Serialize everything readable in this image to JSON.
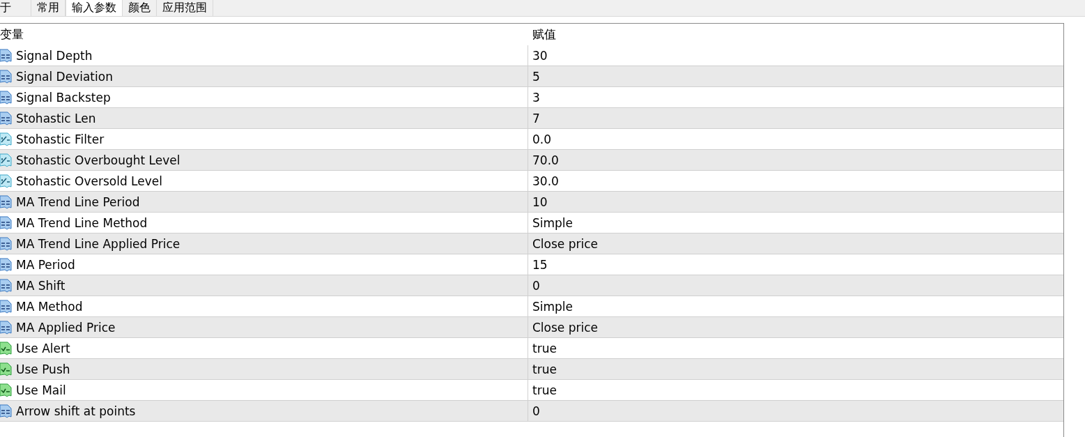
{
  "tabs": [
    {
      "label": "于",
      "selected": false
    },
    {
      "label": "常用",
      "selected": false
    },
    {
      "label": "输入参数",
      "selected": true
    },
    {
      "label": "颜色",
      "selected": false
    },
    {
      "label": "应用范围",
      "selected": false
    }
  ],
  "table": {
    "columns": [
      "变量",
      "赋值"
    ],
    "rows": [
      {
        "kind": "int",
        "name": "Signal Depth",
        "value": "30"
      },
      {
        "kind": "int",
        "name": "Signal Deviation",
        "value": "5"
      },
      {
        "kind": "int",
        "name": "Signal Backstep",
        "value": "3"
      },
      {
        "kind": "int",
        "name": "Stohastic Len",
        "value": "7"
      },
      {
        "kind": "double",
        "name": "Stohastic Filter",
        "value": "0.0"
      },
      {
        "kind": "double",
        "name": "Stohastic Overbought Level",
        "value": "70.0"
      },
      {
        "kind": "double",
        "name": "Stohastic Oversold Level",
        "value": "30.0"
      },
      {
        "kind": "int",
        "name": "MA Trend Line Period",
        "value": "10"
      },
      {
        "kind": "int",
        "name": "MA Trend Line Method",
        "value": "Simple"
      },
      {
        "kind": "int",
        "name": "MA Trend Line Applied Price",
        "value": "Close price"
      },
      {
        "kind": "int",
        "name": "MA Period",
        "value": "15"
      },
      {
        "kind": "int",
        "name": "MA Shift",
        "value": "0"
      },
      {
        "kind": "int",
        "name": "MA Method",
        "value": "Simple"
      },
      {
        "kind": "int",
        "name": "MA Applied Price",
        "value": "Close price"
      },
      {
        "kind": "bool",
        "name": "Use Alert",
        "value": "true"
      },
      {
        "kind": "bool",
        "name": "Use Push",
        "value": "true"
      },
      {
        "kind": "bool",
        "name": "Use Mail",
        "value": "true"
      },
      {
        "kind": "int",
        "name": "Arrow shift at points",
        "value": "0"
      }
    ]
  }
}
